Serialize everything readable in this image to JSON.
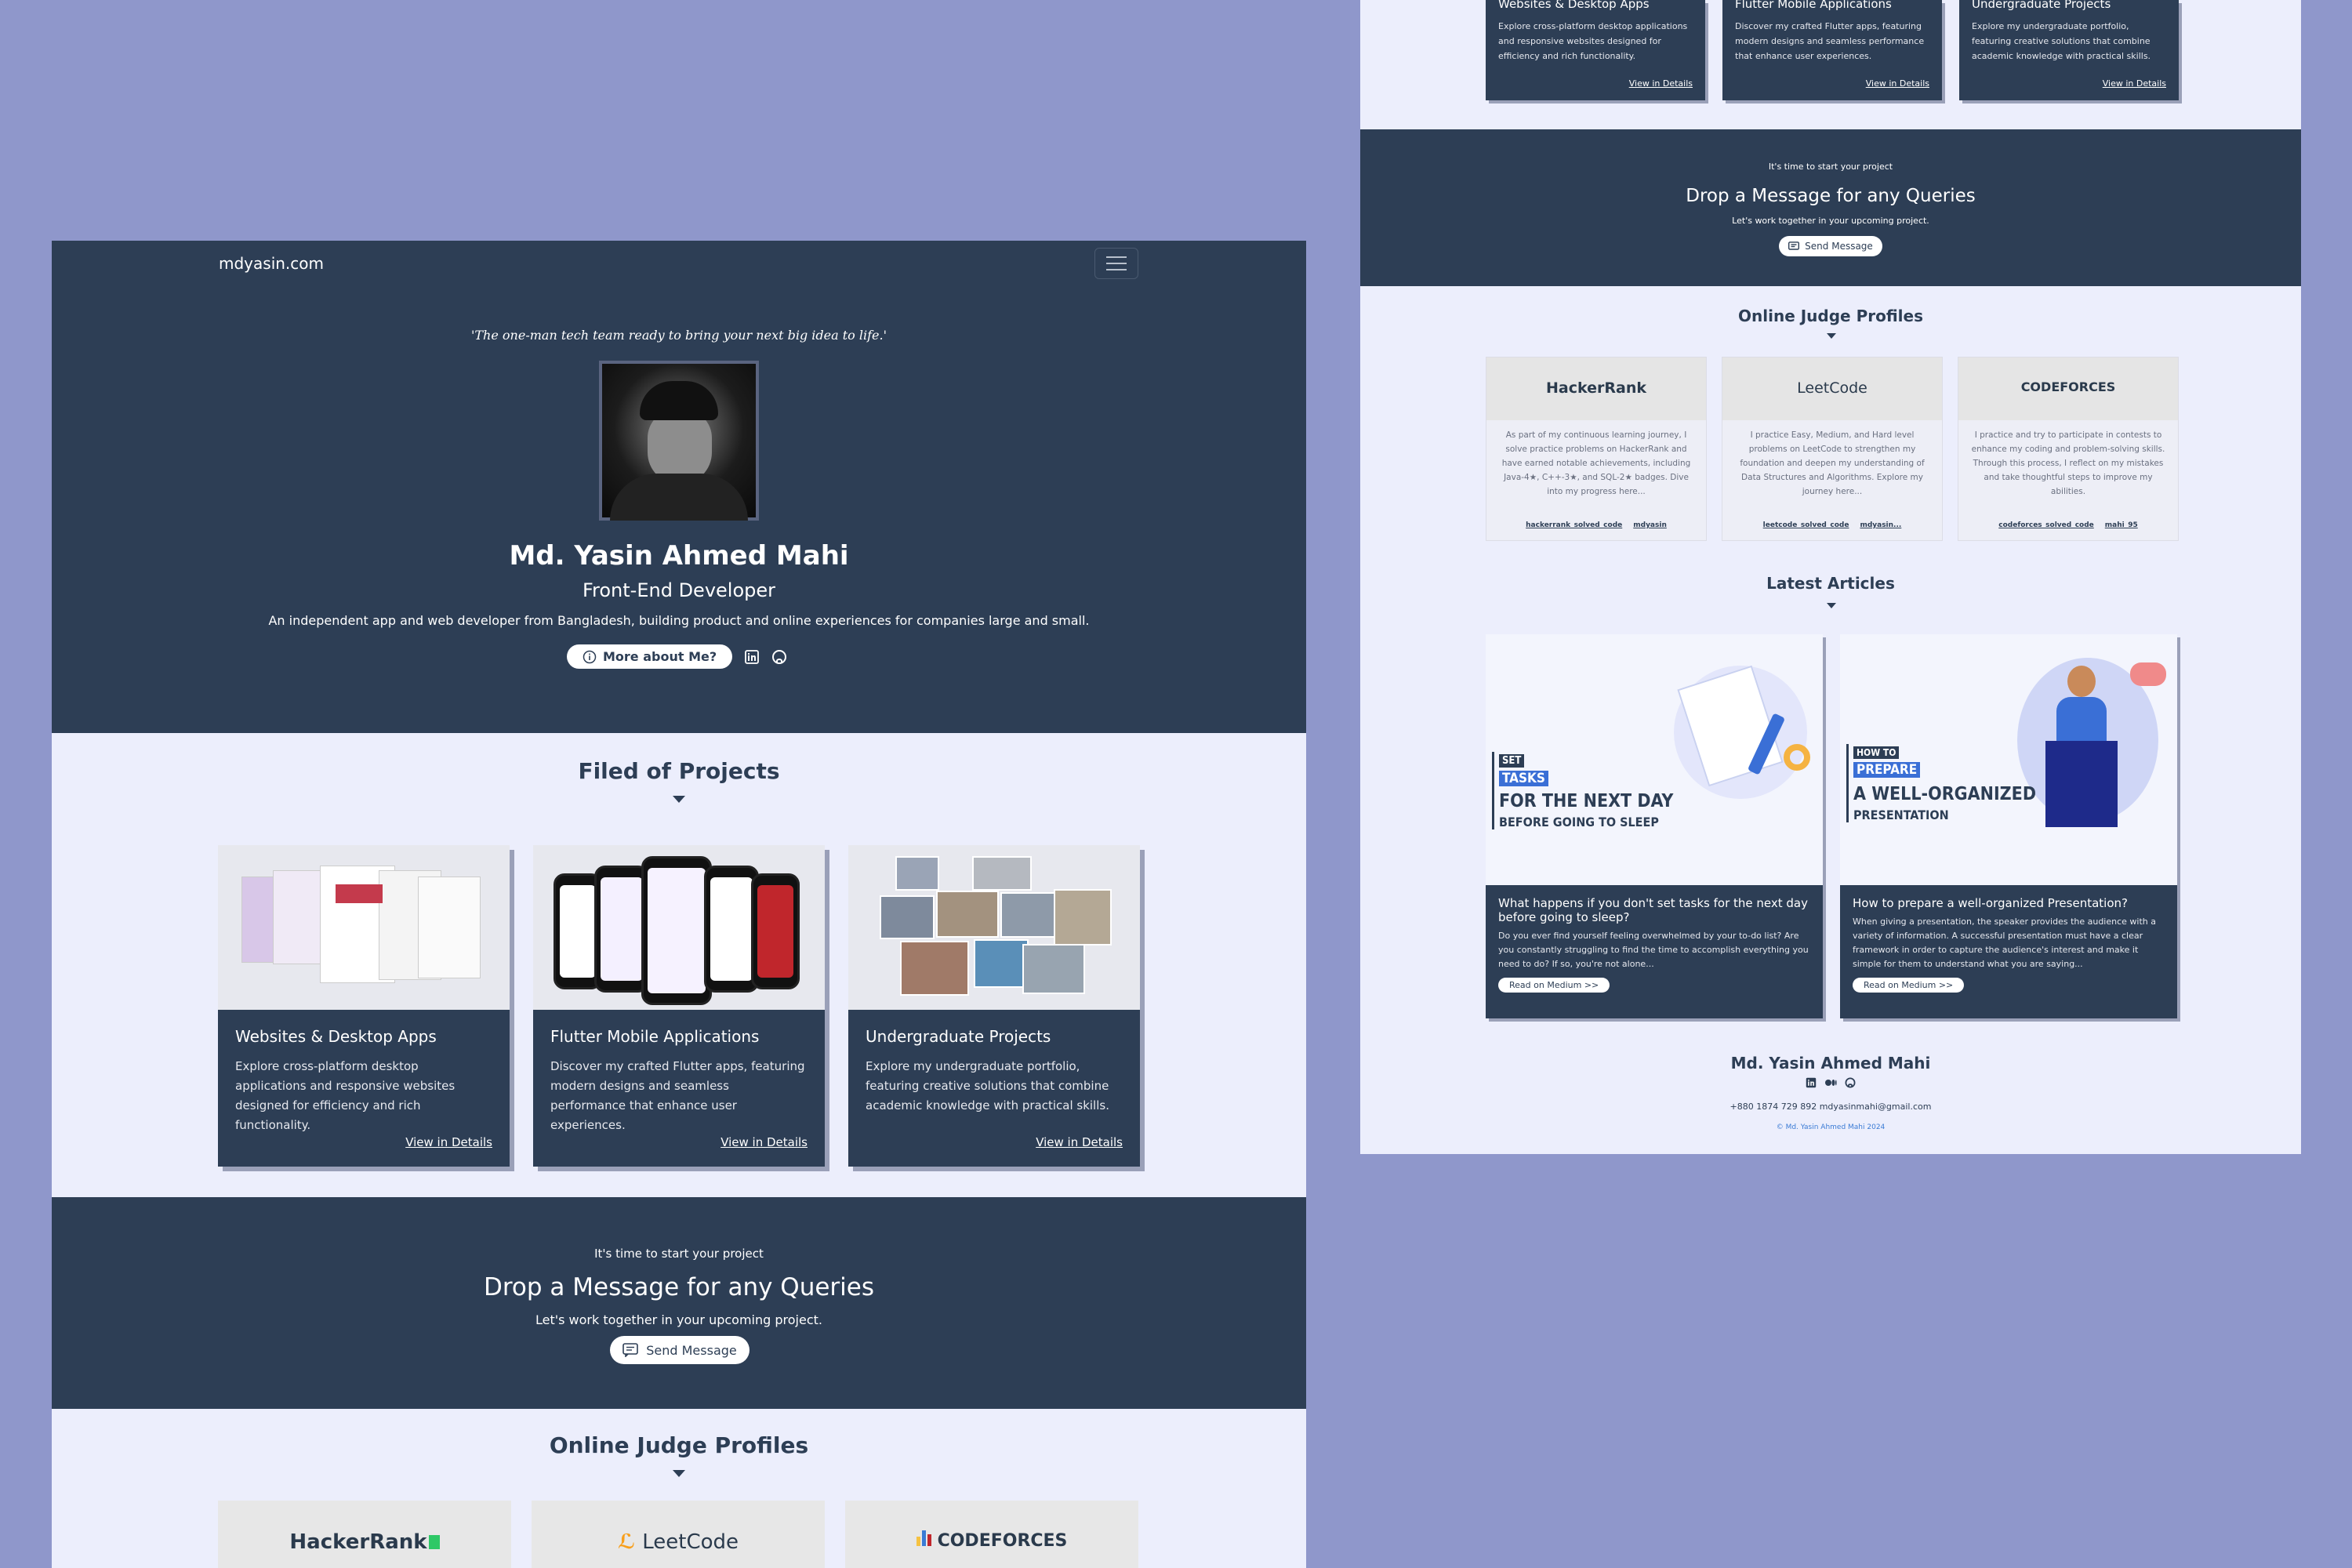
{
  "left": {
    "brand": "mdyasin.com",
    "quote": "'The one-man tech team ready to bring your next big idea to life.'",
    "name": "Md. Yasin Ahmed Mahi",
    "role": "Front-End Developer",
    "description": "An independent app and web developer from Bangladesh, building product and online experiences for companies large and small.",
    "more_button": "More about Me?",
    "projects_title": "Filed of Projects",
    "projects": [
      {
        "title": "Websites & Desktop Apps",
        "desc": "Explore cross-platform desktop applications and responsive websites designed for efficiency and rich functionality.",
        "link": "View in Details"
      },
      {
        "title": "Flutter Mobile Applications",
        "desc": "Discover my crafted Flutter apps, featuring modern designs and seamless performance that enhance user experiences.",
        "link": "View in Details"
      },
      {
        "title": "Undergraduate Projects",
        "desc": "Explore my undergraduate portfolio, featuring creative solutions that combine academic knowledge with practical skills.",
        "link": "View in Details"
      }
    ],
    "cta_kicker": "It's time to start your project",
    "cta_title": "Drop a Message for any Queries",
    "cta_sub": "Let's work together in your upcoming project.",
    "cta_button": "Send Message",
    "judge_title": "Online Judge Profiles",
    "judges": [
      "HackerRank",
      "LeetCode",
      "CODEFORCES"
    ]
  },
  "right": {
    "projects": [
      {
        "title": "Websites & Desktop Apps",
        "desc": "Explore cross-platform desktop applications and responsive websites designed for efficiency and rich functionality.",
        "link": "View in Details"
      },
      {
        "title": "Flutter Mobile Applications",
        "desc": "Discover my crafted Flutter apps, featuring modern designs and seamless performance that enhance user experiences.",
        "link": "View in Details"
      },
      {
        "title": "Undergraduate Projects",
        "desc": "Explore my undergraduate portfolio, featuring creative solutions that combine academic knowledge with practical skills.",
        "link": "View in Details"
      }
    ],
    "cta_kicker": "It's time to start your project",
    "cta_title": "Drop a Message for any Queries",
    "cta_sub": "Let's work together in your upcoming project.",
    "cta_button": "Send Message",
    "judge_title": "Online Judge Profiles",
    "judges": [
      {
        "logo": "HackerRank",
        "desc": "As part of my continuous learning journey, I solve practice problems on HackerRank and have earned notable achievements, including Java-4★, C++-3★, and SQL-2★ badges. Dive into my progress here...",
        "code_link": "hackerrank_solved_code",
        "user": "mdyasin"
      },
      {
        "logo": "LeetCode",
        "desc": "I practice Easy, Medium, and Hard level problems on LeetCode to strengthen my foundation and deepen my understanding of Data Structures and Algorithms. Explore my journey here...",
        "code_link": "leetcode_solved_code",
        "user": "mdyasin..."
      },
      {
        "logo": "CODEFORCES",
        "desc": "I practice and try to participate in contests to enhance my coding and problem-solving skills. Through this process, I reflect on my mistakes and take thoughtful steps to improve my abilities.",
        "code_link": "codeforces_solved_code",
        "user": "mahi_95"
      }
    ],
    "articles_title": "Latest Articles",
    "articles": [
      {
        "title": "What happens if you don't set tasks for the next day before going to sleep?",
        "desc": "Do you ever find yourself feeling overwhelmed by your to-do list? Are you constantly struggling to find the time to accomplish everything you need to do? If so, you're not alone...",
        "button": "Read on Medium >>",
        "poster": [
          "SET",
          "TASKS",
          "FOR THE NEXT DAY",
          "BEFORE GOING TO SLEEP"
        ]
      },
      {
        "title": "How to prepare a well-organized Presentation?",
        "desc": "When giving a presentation, the speaker provides the audience with a variety of information. A successful presentation must have a clear framework in order to capture the audience's interest and make it simple for them to understand what you are saying...",
        "button": "Read on Medium >>",
        "poster": [
          "HOW TO",
          "PREPARE",
          "A WELL-ORGANIZED",
          "PRESENTATION"
        ]
      }
    ],
    "footer_name": "Md. Yasin Ahmed Mahi",
    "footer_contact": "+880 1874 729 892 mdyasinmahi@gmail.com",
    "copyright": "© Md. Yasin Ahmed Mahi 2024"
  },
  "colors": {
    "page_bg": "#8f97cb",
    "navy": "#2d3e55",
    "light_bg": "#eceefc",
    "white": "#ffffff"
  },
  "icons": [
    "hamburger-icon",
    "info-icon",
    "linkedin-icon",
    "github-icon",
    "message-icon",
    "caret-down-icon",
    "medium-icon"
  ]
}
